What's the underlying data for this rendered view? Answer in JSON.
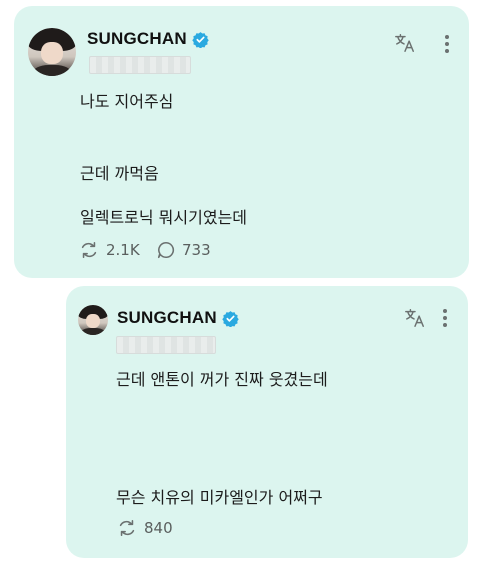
{
  "post": {
    "author": "SUNGCHAN",
    "lines": [
      "나도 지어주심",
      "근데 까먹음",
      " 일렉트로닉 뭐시기였는데"
    ],
    "repost_count": "2.1K",
    "reply_count": "733"
  },
  "reply": {
    "author": "SUNGCHAN",
    "lines": [
      "근데 앤톤이 꺼가 진짜 웃겼는데",
      "무슨 치유의 미카엘인가 어쩌구"
    ],
    "repost_count": "840"
  },
  "icons": [
    "verified-badge-icon",
    "translate-icon",
    "more-options-icon",
    "repost-icon",
    "reply-icon"
  ],
  "colors": {
    "card_background": "#dcf5ef",
    "verified": "#2aa9e0",
    "icon_gray": "#6b7170"
  }
}
